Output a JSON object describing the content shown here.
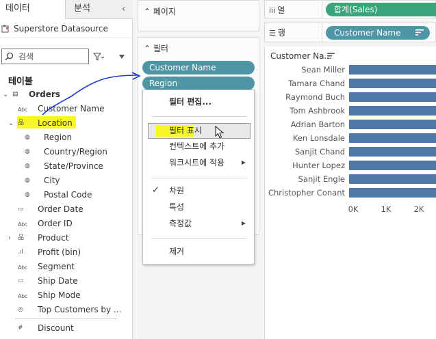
{
  "left_pane": {
    "tabs": [
      "데이터",
      "분석"
    ],
    "datasource": "Superstore Datasource",
    "search_placeholder": "검색",
    "tables_heading": "테이블",
    "abc_badge": "Abc",
    "fields": [
      {
        "label": "Orders",
        "level": 0,
        "icon": "table-icon",
        "chevron": "down"
      },
      {
        "label": "Customer Name",
        "level": 1,
        "icon": "abc"
      },
      {
        "label": "Location",
        "level": 1,
        "icon": "hierarchy-icon",
        "chevron": "down"
      },
      {
        "label": "Region",
        "level": 2,
        "icon": "globe-icon"
      },
      {
        "label": "Country/Region",
        "level": 2,
        "icon": "globe-icon"
      },
      {
        "label": "State/Province",
        "level": 2,
        "icon": "globe-icon"
      },
      {
        "label": "City",
        "level": 2,
        "icon": "globe-icon"
      },
      {
        "label": "Postal Code",
        "level": 2,
        "icon": "globe-icon"
      },
      {
        "label": "Order Date",
        "level": 1,
        "icon": "calendar-icon"
      },
      {
        "label": "Order ID",
        "level": 1,
        "icon": "abc"
      },
      {
        "label": "Product",
        "level": 1,
        "icon": "hierarchy-icon",
        "chevron": "right"
      },
      {
        "label": "Profit (bin)",
        "level": 1,
        "icon": "bin-icon"
      },
      {
        "label": "Segment",
        "level": 1,
        "icon": "abc"
      },
      {
        "label": "Ship Date",
        "level": 1,
        "icon": "calendar-icon"
      },
      {
        "label": "Ship Mode",
        "level": 1,
        "icon": "abc"
      },
      {
        "label": "Top Customers by ...",
        "level": 1,
        "icon": "set-icon"
      },
      {
        "label": "Discount",
        "level": 1,
        "icon": "hash-icon"
      }
    ]
  },
  "shelves": {
    "pages_label": "페이지",
    "filters_label": "필터",
    "filter_pills": [
      "Customer Name",
      "Region"
    ],
    "columns_label": "열",
    "rows_label": "행",
    "columns_pill": "합계(Sales)",
    "rows_pill": "Customer Name"
  },
  "context_menu": {
    "items": [
      {
        "label": "필터 편집...",
        "bold": true
      },
      {
        "label": "필터 표시",
        "highlighted": true
      },
      {
        "label": "컨텍스트에 추가"
      },
      {
        "label": "워크시트에 적용",
        "submenu": true
      },
      {
        "label": "차원",
        "checked": true
      },
      {
        "label": "특성"
      },
      {
        "label": "측정값",
        "submenu": true
      },
      {
        "label": "제거"
      }
    ]
  },
  "colors": {
    "pill_dimension": "#4e96a6",
    "pill_measure": "#3aa57a",
    "bar": "#4e79a7",
    "highlight": "#f6f62a",
    "annotation": "#1a3ad6"
  },
  "chart_data": {
    "type": "bar",
    "orientation": "horizontal",
    "header": "Customer Na...",
    "categories": [
      "Sean Miller",
      "Tamara Chand",
      "Raymond Buch",
      "Tom Ashbrook",
      "Adrian Barton",
      "Ken Lonsdale",
      "Sanjit Chand",
      "Hunter Lopez",
      "Sanjit Engle",
      "Christopher Conant"
    ],
    "values": [
      25000,
      19000,
      15000,
      14600,
      14500,
      14200,
      14100,
      12900,
      12200,
      12100
    ],
    "x_ticks": [
      "0K",
      "1K",
      "2K"
    ],
    "xlim": [
      0,
      2500
    ]
  }
}
